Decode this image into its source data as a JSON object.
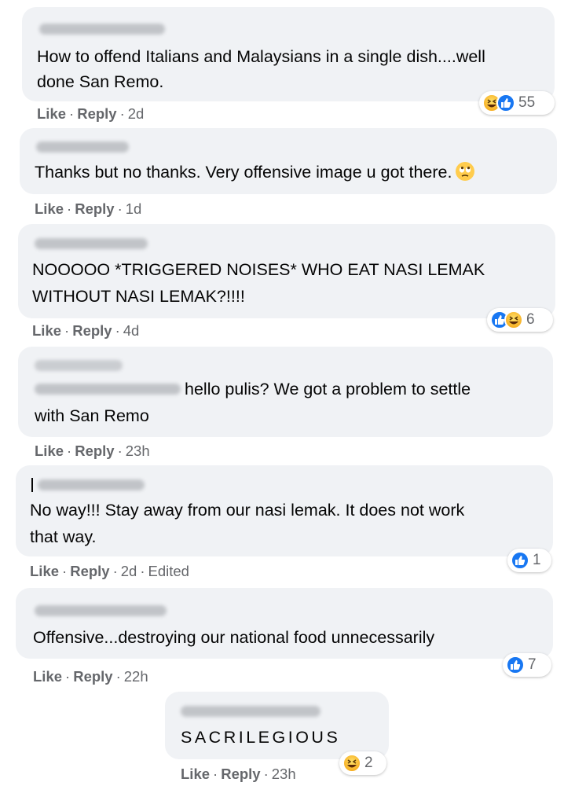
{
  "comments": [
    {
      "text_lines": [
        "How to offend Italians and Malaysians in a single dish....well",
        "done San Remo."
      ],
      "actions": {
        "like": "Like",
        "reply": "Reply",
        "time": "2d",
        "edited": ""
      },
      "reactions": {
        "icons": [
          "haha",
          "like"
        ],
        "count": "55"
      }
    },
    {
      "text_lines": [
        "Thanks but no thanks. Very offensive image u got there."
      ],
      "inline_emoji": "rolling-eyes-emoji",
      "actions": {
        "like": "Like",
        "reply": "Reply",
        "time": "1d",
        "edited": ""
      }
    },
    {
      "text_lines": [
        "NOOOOO *TRIGGERED NOISES* WHO EAT NASI LEMAK",
        "WITHOUT NASI LEMAK?!!!!"
      ],
      "actions": {
        "like": "Like",
        "reply": "Reply",
        "time": "4d",
        "edited": ""
      },
      "reactions": {
        "icons": [
          "like",
          "haha"
        ],
        "count": "6"
      }
    },
    {
      "text_lines": [
        "hello pulis? We got a problem to settle",
        "with San Remo"
      ],
      "actions": {
        "like": "Like",
        "reply": "Reply",
        "time": "23h",
        "edited": ""
      }
    },
    {
      "text_lines": [
        "No way!!! Stay away from our nasi lemak. It does not work",
        "that way."
      ],
      "actions": {
        "like": "Like",
        "reply": "Reply",
        "time": "2d",
        "edited": "Edited"
      },
      "reactions": {
        "icons": [
          "like"
        ],
        "count": "1"
      }
    },
    {
      "text_lines": [
        "Offensive...destroying our national food unnecessarily"
      ],
      "actions": {
        "like": "Like",
        "reply": "Reply",
        "time": "22h",
        "edited": ""
      },
      "reactions": {
        "icons": [
          "like"
        ],
        "count": "7"
      }
    },
    {
      "text_lines": [
        "SACRILEGIOUS"
      ],
      "actions": {
        "like": "Like",
        "reply": "Reply",
        "time": "23h",
        "edited": ""
      },
      "reactions": {
        "icons": [
          "haha"
        ],
        "count": "2"
      }
    }
  ],
  "separator": "·",
  "colors": {
    "bubble": "#f0f2f5",
    "meta": "#65676b",
    "like": "#1877f2",
    "haha": "#f7b125"
  }
}
